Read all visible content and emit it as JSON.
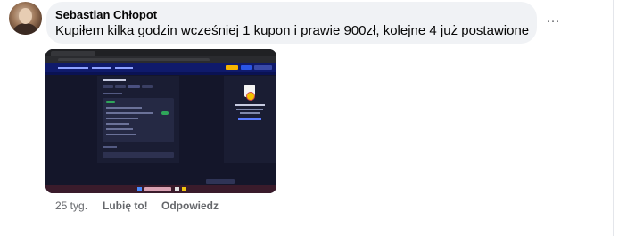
{
  "comment": {
    "author": "Sebastian Chłopot",
    "text": "Kupiłem kilka godzin wcześniej 1 kupon i prawie 900zł, kolejne 4 już postawione",
    "more_icon": "…"
  },
  "attachment": {
    "kind": "screenshot-image",
    "icon": "betting-app-screenshot"
  },
  "actions": {
    "time": "25 tyg.",
    "like": "Lubię to!",
    "reply": "Odpowiedz"
  },
  "colors": {
    "bubble": "#f0f2f5",
    "meta_text": "#65676b",
    "screenshot_bg": "#14162a",
    "app_nav": "#0f1a6b",
    "accent_green": "#2fa65a",
    "accent_yellow": "#f5b400"
  }
}
